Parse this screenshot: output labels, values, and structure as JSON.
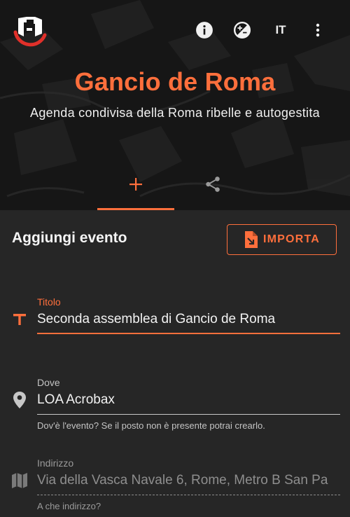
{
  "app": {
    "title": "Gancio de Roma",
    "subtitle": "Agenda condivisa della Roma ribelle e autogestita",
    "language": "IT"
  },
  "icons": {
    "logo": "gancio-logo",
    "info": "info-icon",
    "theme": "theme-toggle-icon",
    "menu": "more-vert-icon",
    "add_tab": "plus-icon",
    "share_tab": "share-icon",
    "import": "file-import-icon",
    "title_field": "text-icon",
    "place_field": "map-marker-icon",
    "address_field": "map-icon"
  },
  "colors": {
    "accent": "#ff6f3c",
    "background": "#262626",
    "hero": "#161616"
  },
  "form": {
    "section_title": "Aggiungi evento",
    "import_label": "IMPORTA",
    "title_field": {
      "label": "Titolo",
      "value": "Seconda assemblea di Gancio de Roma"
    },
    "place_field": {
      "label": "Dove",
      "value": "LOA Acrobax",
      "hint": "Dov'è l'evento? Se il posto non è presente potrai crearlo."
    },
    "address_field": {
      "label": "Indirizzo",
      "value": "Via della Vasca Navale 6, Rome, Metro B San Pa",
      "hint": "A che indirizzo?"
    }
  }
}
